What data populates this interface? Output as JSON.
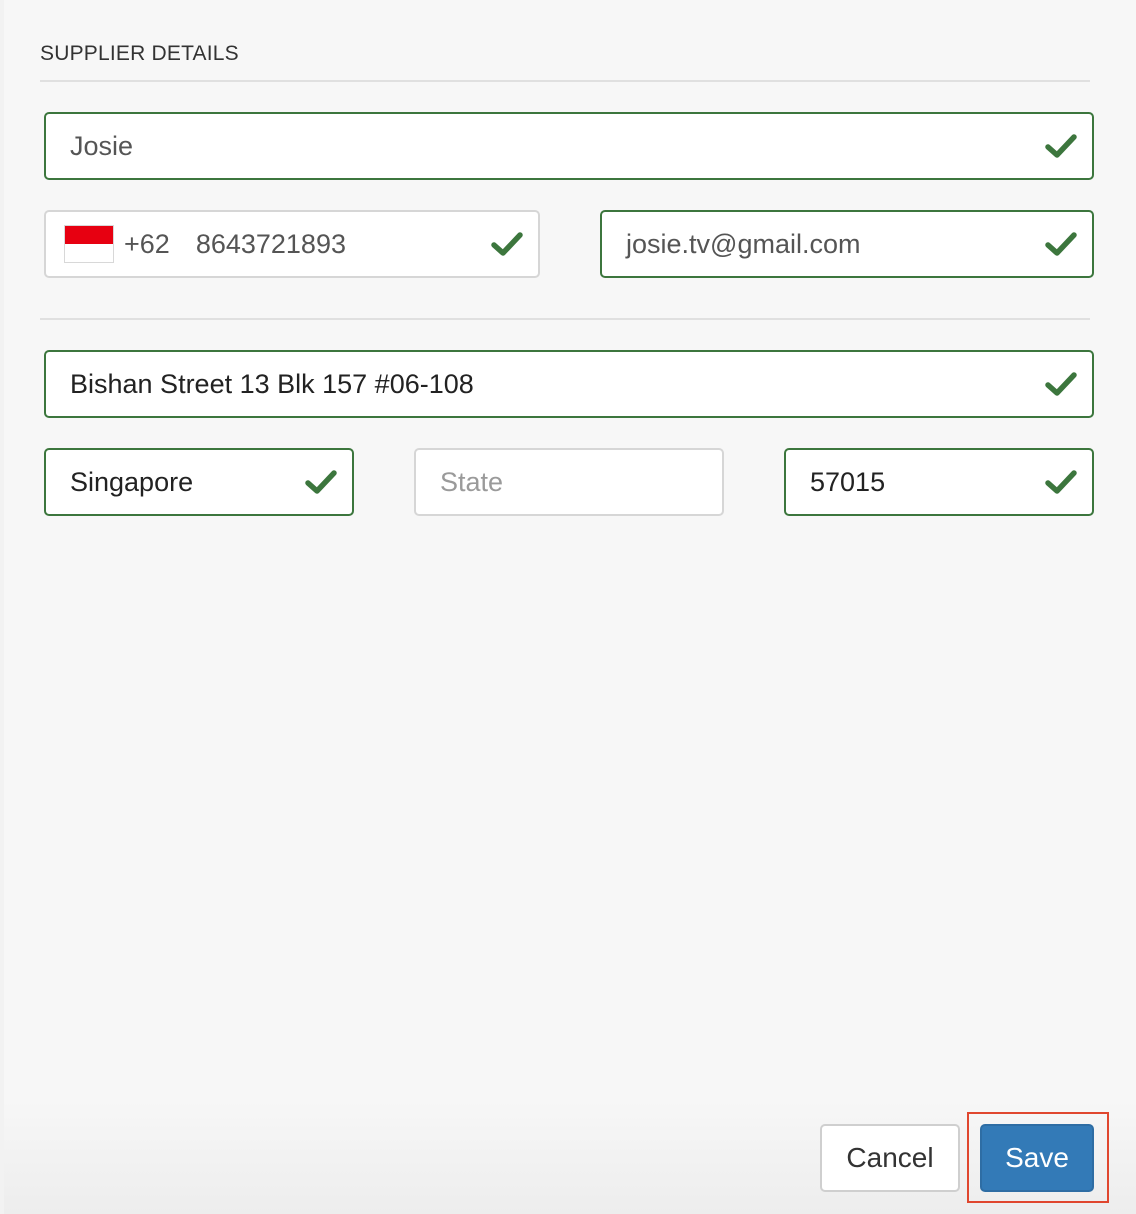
{
  "section": {
    "title": "SUPPLIER DETAILS"
  },
  "fields": {
    "name": {
      "value": "Josie"
    },
    "phone": {
      "dial_code": "+62",
      "number": "8643721893",
      "flag": "indonesia-flag"
    },
    "email": {
      "value": "josie.tv@gmail.com"
    },
    "address": {
      "value": "Bishan Street 13 Blk 157 #06-108"
    },
    "city": {
      "value": "Singapore"
    },
    "state": {
      "value": "",
      "placeholder": "State"
    },
    "postal": {
      "value": "57015"
    }
  },
  "footer": {
    "cancel_label": "Cancel",
    "save_label": "Save"
  },
  "colors": {
    "valid_border": "#3c763d",
    "check": "#3c763d",
    "save_button": "#337ab7",
    "highlight": "#e0472f"
  },
  "icons": {
    "valid": "checkmark-icon"
  }
}
